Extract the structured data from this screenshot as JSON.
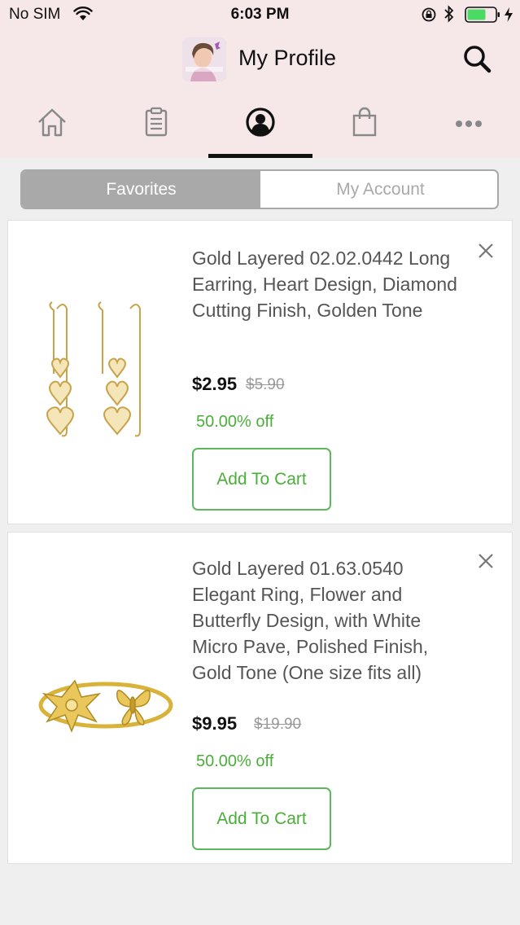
{
  "status_bar": {
    "carrier": "No SIM",
    "time": "6:03 PM"
  },
  "header": {
    "title": "My Profile"
  },
  "nav_tabs": {
    "items": [
      {
        "icon": "home-icon"
      },
      {
        "icon": "clipboard-icon"
      },
      {
        "icon": "user-circle-icon",
        "active": true
      },
      {
        "icon": "shopping-bag-icon"
      },
      {
        "icon": "more-icon"
      }
    ]
  },
  "segment": {
    "favorites_label": "Favorites",
    "account_label": "My Account"
  },
  "products": [
    {
      "name": "Gold Layered 02.02.0442 Long Earring, Heart Design, Diamond Cutting Finish, Golden Tone",
      "price": "$2.95",
      "old_price": "$5.90",
      "discount": "50.00% off",
      "button": "Add To Cart"
    },
    {
      "name": "Gold Layered 01.63.0540 Elegant Ring, Flower and Butterfly Design, with White Micro Pave, Polished Finish, Gold Tone (One size fits all)",
      "price": "$9.95",
      "old_price": "$19.90",
      "discount": "50.00% off",
      "button": "Add To Cart"
    }
  ],
  "colors": {
    "header_bg": "#f6e7e9",
    "accent_green": "#4cae3a",
    "segment_active": "#a9a9a9"
  }
}
